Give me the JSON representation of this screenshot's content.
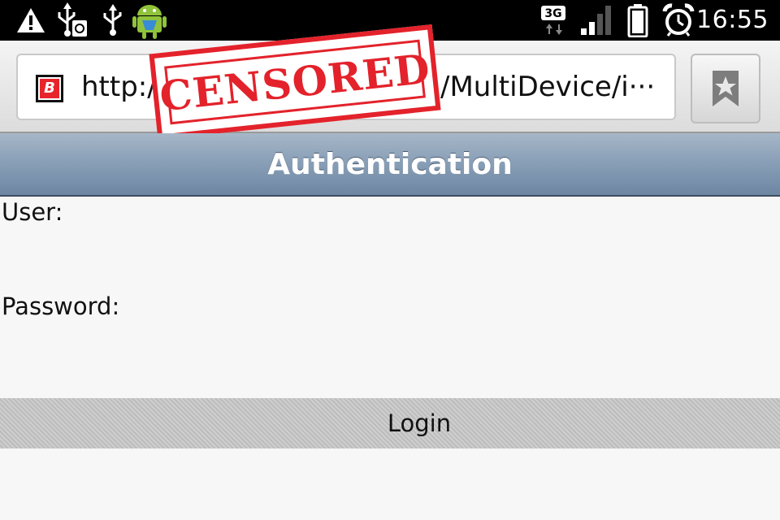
{
  "status_bar": {
    "time": "16:55",
    "network": "3G",
    "icons": [
      "warning-icon",
      "usb-debug-icon",
      "usb-icon",
      "android-icon",
      "network-3g-icon",
      "signal-icon",
      "battery-icon",
      "alarm-icon"
    ]
  },
  "browser": {
    "url_start": "http:/",
    "url_end": "/MultiDevice/i···",
    "favicon_letter": "B",
    "censor_stamp": "CENSORED",
    "bookmark_icon": "bookmark-star-icon"
  },
  "page": {
    "header_title": "Authentication",
    "user_label": "User:",
    "user_value": "",
    "password_label": "Password:",
    "password_value": "",
    "login_label": "Login"
  },
  "colors": {
    "header_gradient_top": "#a6b7c8",
    "header_gradient_bottom": "#6d86a3",
    "censor_red": "#e3222b",
    "login_button": "#c4c4c4"
  }
}
